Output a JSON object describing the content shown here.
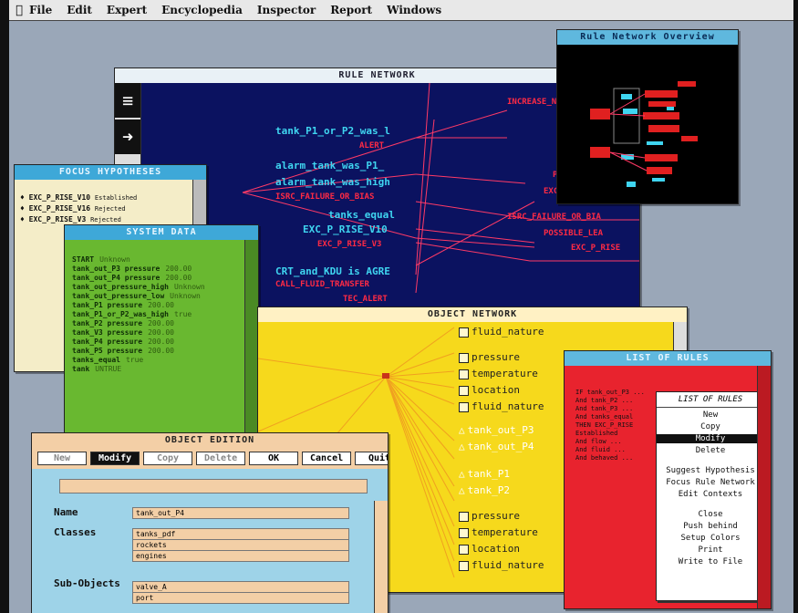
{
  "menubar": {
    "items": [
      "File",
      "Edit",
      "Expert",
      "Encyclopedia",
      "Inspector",
      "Report",
      "Windows"
    ]
  },
  "rule_network": {
    "title": "RULE NETWORK",
    "nodes": [
      {
        "text": "tank_P1_or_P2_was_l",
        "color": "cyan"
      },
      {
        "text": "ALERT",
        "color": "red"
      },
      {
        "text": "alarm_tank_was_P1_",
        "color": "cyan"
      },
      {
        "text": "alarm_tank_was_high",
        "color": "cyan"
      },
      {
        "text": "ISRC_FAILURE_OR_BIAS",
        "color": "red"
      },
      {
        "text": "tanks_equal",
        "color": "cyan"
      },
      {
        "text": "EXC_P_RISE_V10",
        "color": "cyan"
      },
      {
        "text": "EXC_P_RISE_V3",
        "color": "red"
      },
      {
        "text": "CRT_and_KDU is AGRE",
        "color": "cyan"
      },
      {
        "text": "CALL_FLUID_TRANSFER",
        "color": "red"
      },
      {
        "text": "TEC_ALERT",
        "color": "red"
      }
    ],
    "right_nodes": [
      "INCREASE_N",
      "PO",
      "EXC",
      "ISRC_FAILURE_OR_BIA",
      "POSSIBLE_LEA",
      "EXC_P_RISE"
    ]
  },
  "overview": {
    "title": "Rule Network Overview"
  },
  "focus": {
    "title": "FOCUS HYPOTHESES",
    "items": [
      {
        "name": "EXC_P_RISE_V10",
        "status": "Established"
      },
      {
        "name": "EXC_P_RISE_V16",
        "status": "Rejected"
      },
      {
        "name": "EXC_P_RISE_V3",
        "status": "Rejected"
      }
    ]
  },
  "system_data": {
    "title": "SYSTEM DATA",
    "lines": [
      {
        "k": "START",
        "v": "Unknown"
      },
      {
        "k": "tank_out_P3 pressure",
        "v": "200.00"
      },
      {
        "k": "tank_out_P4 pressure",
        "v": "200.00"
      },
      {
        "k": "tank_out_pressure_high",
        "v": "Unknown"
      },
      {
        "k": "tank_out_pressure_low",
        "v": "Unknown"
      },
      {
        "k": "tank_P1 pressure",
        "v": "200.00"
      },
      {
        "k": "tank_P1_or_P2_was_high",
        "v": "true"
      },
      {
        "k": "tank_P2 pressure",
        "v": "200.00"
      },
      {
        "k": "tank_V3 pressure",
        "v": "200.00"
      },
      {
        "k": "tank_P4 pressure",
        "v": "200.00"
      },
      {
        "k": "tank_P5 pressure",
        "v": "200.00"
      },
      {
        "k": "tanks_equal",
        "v": "true"
      },
      {
        "k": "tank",
        "v": "UNTRUE"
      }
    ]
  },
  "object_network": {
    "title": "OBJECT NETWORK",
    "items": [
      {
        "text": "fluid_nature",
        "kind": "box"
      },
      {
        "text": "pressure",
        "kind": "box"
      },
      {
        "text": "temperature",
        "kind": "box"
      },
      {
        "text": "location",
        "kind": "box"
      },
      {
        "text": "fluid_nature",
        "kind": "box"
      },
      {
        "text": "tank_out_P3",
        "kind": "tri"
      },
      {
        "text": "tank_out_P4",
        "kind": "tri"
      },
      {
        "text": "tank_P1",
        "kind": "tri"
      },
      {
        "text": "tank_P2",
        "kind": "tri"
      },
      {
        "text": "pressure",
        "kind": "box"
      },
      {
        "text": "temperature",
        "kind": "box"
      },
      {
        "text": "location",
        "kind": "box"
      },
      {
        "text": "fluid_nature",
        "kind": "box"
      }
    ]
  },
  "object_edition": {
    "title": "OBJECT EDITION",
    "buttons": [
      "New",
      "Modify",
      "Copy",
      "Delete",
      "OK",
      "Cancel",
      "Quit"
    ],
    "name_label": "Name",
    "name_value": "tank_out_P4",
    "classes_label": "Classes",
    "classes": [
      "tanks_pdf",
      "rockets",
      "engines"
    ],
    "subobjects_label": "Sub-Objects",
    "subobjects": [
      "valve_A",
      "port"
    ]
  },
  "list_of_rules": {
    "title": "LIST OF RULES",
    "menu_title": "LIST OF RULES",
    "menu": [
      "New",
      "Copy",
      "Modify",
      "Delete",
      "Suggest Hypothesis",
      "Focus Rule Network",
      "Edit Contexts",
      "Close",
      "Push behind",
      "Setup Colors",
      "Print",
      "Write to File"
    ],
    "selected": "Modify"
  }
}
